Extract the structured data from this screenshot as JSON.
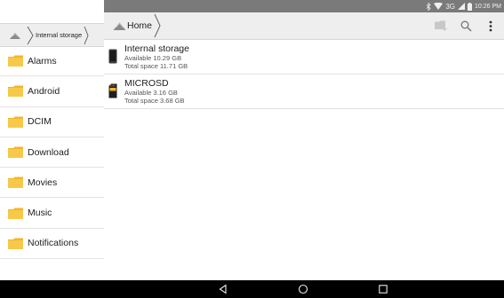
{
  "drawer": {
    "breadcrumb": {
      "current": "Internal storage"
    },
    "folders": [
      {
        "label": "Alarms"
      },
      {
        "label": "Android"
      },
      {
        "label": "DCIM"
      },
      {
        "label": "Download"
      },
      {
        "label": "Movies"
      },
      {
        "label": "Music"
      },
      {
        "label": "Notifications"
      }
    ]
  },
  "status_bar": {
    "network": "3G",
    "time": "10:26 PM"
  },
  "toolbar": {
    "home_label": "Home",
    "icons": [
      "new-folder-icon",
      "search-icon",
      "overflow-menu-icon"
    ]
  },
  "storage": [
    {
      "name": "Internal storage",
      "available": "Available 10.29 GB",
      "total": "Total space 11.71 GB",
      "icon": "phone-storage-icon"
    },
    {
      "name": "MICROSD",
      "available": "Available 3.16 GB",
      "total": "Total space 3.68 GB",
      "icon": "sd-card-icon"
    }
  ],
  "nav_bar": {
    "icons": [
      "back-icon",
      "home-icon",
      "recents-icon"
    ]
  },
  "colors": {
    "folder": "#f3b52a",
    "toolbar_bg": "#eeeeee",
    "status_bar_bg": "#7a7a7a"
  }
}
